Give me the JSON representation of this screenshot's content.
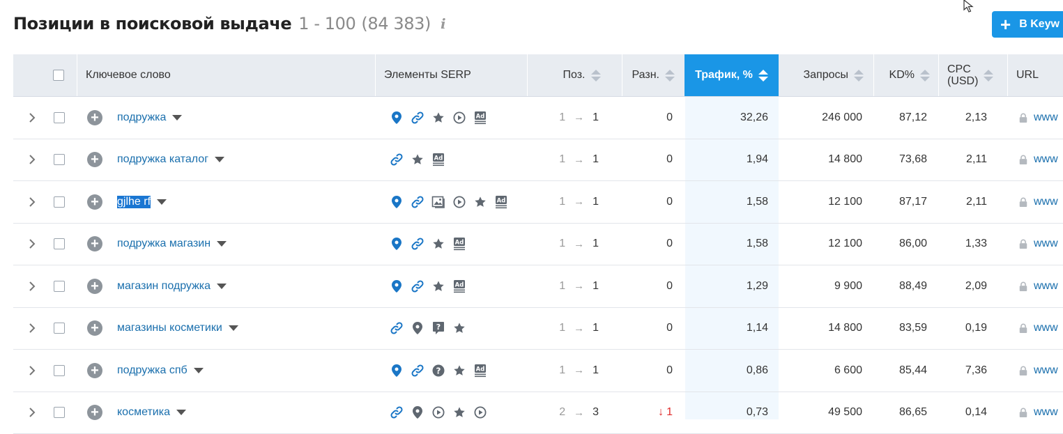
{
  "header": {
    "title": "Позиции в поисковой выдаче",
    "range": "1 - 100",
    "total": "(84 383)",
    "info_icon": "info-icon"
  },
  "export_button": {
    "label": "В Keyw",
    "icon": "plus-icon",
    "color": "#1a96e6"
  },
  "columns": {
    "keyword": "Ключевое слово",
    "serp": "Элементы SERP",
    "pos": "Поз.",
    "diff": "Разн.",
    "traffic": "Трафик, %",
    "volume": "Запросы",
    "kd": "KD%",
    "cpc_line1": "CPC",
    "cpc_line2": "(USD)",
    "url": "URL"
  },
  "rows": [
    {
      "keyword": "подружка",
      "serp": [
        "local-pack-icon",
        "sitelinks-icon",
        "reviews-icon",
        "video-icon",
        "ads-icon"
      ],
      "prev": "1",
      "pos": "1",
      "diff": "0",
      "traffic": "32,26",
      "volume": "246 000",
      "kd": "87,12",
      "cpc": "2,13",
      "url": "www",
      "selected": false
    },
    {
      "keyword": "подружка каталог",
      "serp": [
        "sitelinks-icon",
        "reviews-icon",
        "ads-icon"
      ],
      "prev": "1",
      "pos": "1",
      "diff": "0",
      "traffic": "1,94",
      "volume": "14 800",
      "kd": "73,68",
      "cpc": "2,11",
      "url": "www",
      "selected": false
    },
    {
      "keyword": "gjlhe rf",
      "serp": [
        "local-pack-icon",
        "sitelinks-icon",
        "image-icon",
        "video-icon",
        "reviews-icon",
        "ads-icon"
      ],
      "prev": "1",
      "pos": "1",
      "diff": "0",
      "traffic": "1,58",
      "volume": "12 100",
      "kd": "87,17",
      "cpc": "2,11",
      "url": "www",
      "selected": true
    },
    {
      "keyword": "подружка магазин",
      "serp": [
        "local-pack-icon",
        "sitelinks-icon",
        "reviews-icon",
        "ads-icon"
      ],
      "prev": "1",
      "pos": "1",
      "diff": "0",
      "traffic": "1,58",
      "volume": "12 100",
      "kd": "86,00",
      "cpc": "1,33",
      "url": "www",
      "selected": false
    },
    {
      "keyword": "магазин подружка",
      "serp": [
        "local-pack-icon",
        "sitelinks-icon",
        "reviews-icon",
        "ads-icon"
      ],
      "prev": "1",
      "pos": "1",
      "diff": "0",
      "traffic": "1,29",
      "volume": "9 900",
      "kd": "88,49",
      "cpc": "2,09",
      "url": "www",
      "selected": false
    },
    {
      "keyword": "магазины косметики",
      "serp": [
        "sitelinks-icon",
        "local-pack-gray-icon",
        "faq-icon",
        "reviews-icon"
      ],
      "prev": "1",
      "pos": "1",
      "diff": "0",
      "traffic": "1,14",
      "volume": "14 800",
      "kd": "83,59",
      "cpc": "0,19",
      "url": "www",
      "selected": false
    },
    {
      "keyword": "подружка спб",
      "serp": [
        "local-pack-icon",
        "sitelinks-icon",
        "question-icon",
        "reviews-icon",
        "ads-icon"
      ],
      "prev": "1",
      "pos": "1",
      "diff": "0",
      "traffic": "0,86",
      "volume": "6 600",
      "kd": "85,44",
      "cpc": "7,36",
      "url": "www",
      "selected": false
    },
    {
      "keyword": "косметика",
      "serp": [
        "sitelinks-icon",
        "local-pack-gray-icon",
        "video-icon",
        "reviews-icon",
        "video-icon"
      ],
      "prev": "2",
      "pos": "3",
      "diff": "1",
      "diff_direction": "down",
      "traffic": "0,73",
      "volume": "49 500",
      "kd": "86,65",
      "cpc": "0,14",
      "url": "www",
      "selected": false
    }
  ],
  "colors": {
    "accent": "#1a96e6",
    "link": "#1a6fad",
    "header_bg": "#e8ecf1",
    "negative": "#e02b2b"
  }
}
